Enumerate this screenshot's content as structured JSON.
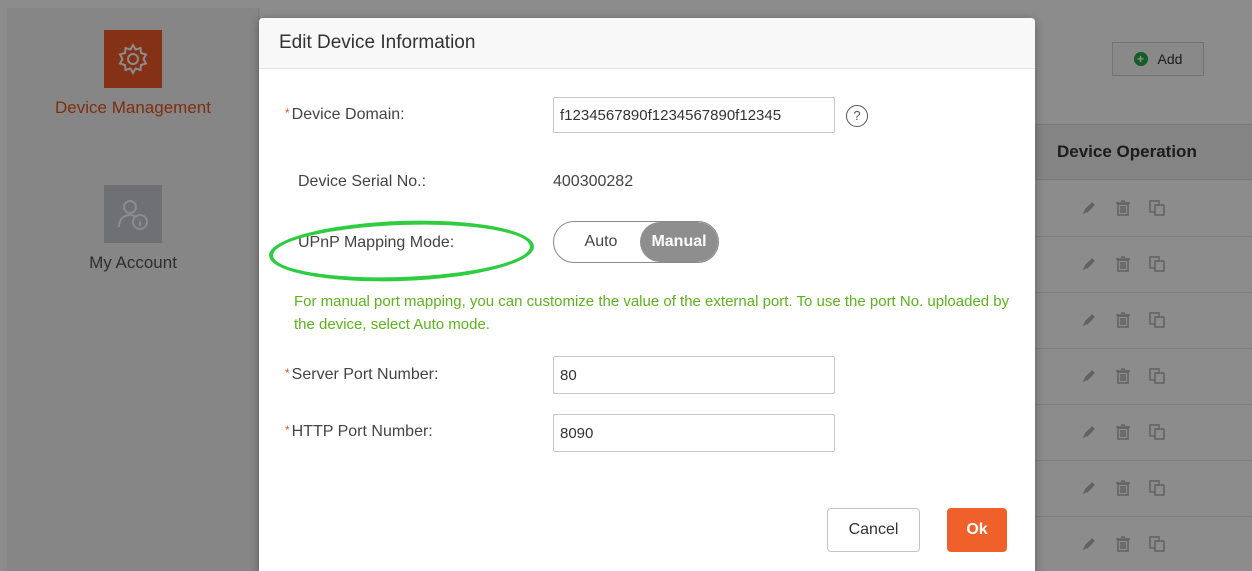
{
  "sidebar": {
    "items": [
      {
        "label": "Device Management",
        "icon": "gear-icon",
        "active": true
      },
      {
        "label": "My Account",
        "icon": "user-info-icon",
        "active": false
      }
    ]
  },
  "toolbar": {
    "add_label": "Add",
    "add_icon": "plus-circle-icon"
  },
  "table": {
    "operation_header": "Device Operation",
    "row_icons": [
      "edit-icon",
      "delete-icon",
      "copy-icon"
    ]
  },
  "modal": {
    "title": "Edit Device Information",
    "device_domain": {
      "label": "Device Domain:",
      "value": "f1234567890f1234567890f12345"
    },
    "help_glyph": "?",
    "serial": {
      "label": "Device Serial No.:",
      "value": "400300282"
    },
    "upnp": {
      "label": "UPnP Mapping Mode:",
      "options": [
        "Auto",
        "Manual"
      ],
      "selected": "Manual"
    },
    "hint": "For manual port mapping, you can customize the value of the external port. To use the port No. uploaded by the device, select Auto mode.",
    "server_port": {
      "label": "Server Port Number:",
      "value": "80"
    },
    "http_port": {
      "label": "HTTP Port Number:",
      "value": "8090"
    },
    "required_mark": "*",
    "cancel_label": "Cancel",
    "ok_label": "Ok"
  },
  "colors": {
    "accent": "#f0602a",
    "hint_green": "#5cb31c",
    "highlight": "#2ecc40"
  }
}
